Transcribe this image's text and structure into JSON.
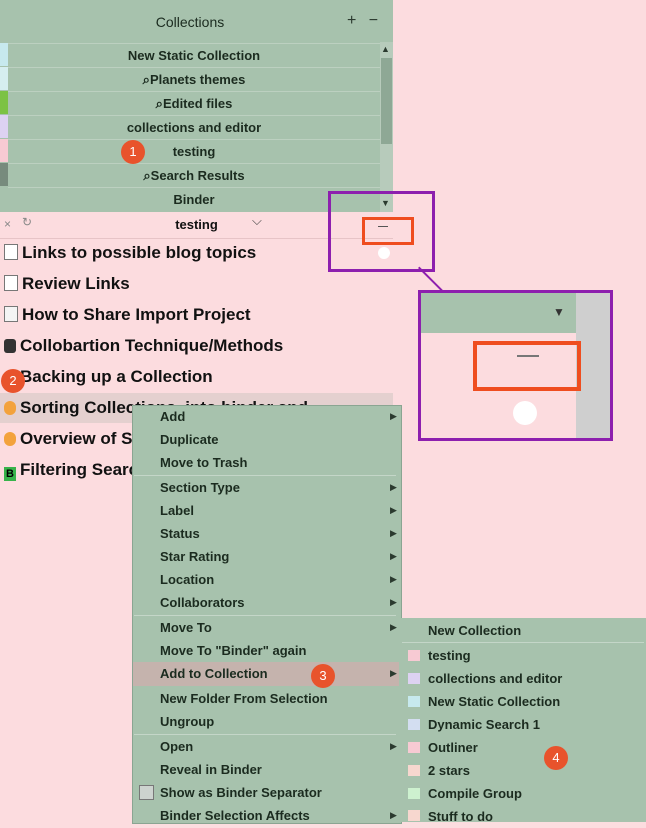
{
  "collections_panel": {
    "title": "Collections",
    "add_button": "+",
    "remove_button": "−",
    "rows": [
      {
        "label": "New Static Collection",
        "color": "#c7e9ee"
      },
      {
        "label": "⌕Planets themes",
        "color": "#d6eef0"
      },
      {
        "label": "⌕Edited files",
        "color": "#7cc244"
      },
      {
        "label": "collections and editor",
        "color": "#ddd2f2"
      },
      {
        "label": "testing",
        "color": "#f7cad3"
      },
      {
        "label": "⌕Search Results",
        "color": "#778b7d"
      },
      {
        "label": "Binder",
        "color": "#a7c2ad"
      }
    ]
  },
  "editor": {
    "title": "testing",
    "close_icon": "×",
    "redo_icon": "↻",
    "chevron": "⌵",
    "items": [
      {
        "label": "Links to possible blog topics",
        "icon": "checkbox"
      },
      {
        "label": "Review Links",
        "icon": "checkbox"
      },
      {
        "label": "How to Share Import Project",
        "icon": "document"
      },
      {
        "label": "Collobartion Technique/Methods",
        "icon": "robot"
      },
      {
        "label": "Backing up a Collection",
        "icon": "flame"
      },
      {
        "label": "Sorting Collections, into binder and",
        "icon": "flame"
      },
      {
        "label": "Overview of Sta",
        "icon": "flame"
      },
      {
        "label": "Filtering Search",
        "icon": "b-badge"
      }
    ]
  },
  "context_menu": {
    "items": [
      {
        "label": "Add",
        "submenu": true
      },
      {
        "label": "Duplicate",
        "submenu": false
      },
      {
        "label": "Move to Trash",
        "submenu": false
      },
      {
        "label": "Section Type",
        "submenu": true
      },
      {
        "label": "Label",
        "submenu": true
      },
      {
        "label": "Status",
        "submenu": true
      },
      {
        "label": "Star Rating",
        "submenu": true
      },
      {
        "label": "Location",
        "submenu": true
      },
      {
        "label": "Collaborators",
        "submenu": true
      },
      {
        "label": "Move To",
        "submenu": true
      },
      {
        "label": "Move To \"Binder\" again",
        "submenu": false
      },
      {
        "label": "Add to Collection",
        "submenu": true
      },
      {
        "label": "New Folder From Selection",
        "submenu": false
      },
      {
        "label": "Ungroup",
        "submenu": false
      },
      {
        "label": "Open",
        "submenu": true
      },
      {
        "label": "Reveal in Binder",
        "submenu": false
      },
      {
        "label": "Show as Binder Separator",
        "submenu": false
      },
      {
        "label": "Binder Selection Affects",
        "submenu": true
      }
    ]
  },
  "collection_submenu": {
    "header": "New Collection",
    "items": [
      {
        "label": "testing",
        "color": "#f7cad3"
      },
      {
        "label": "collections and editor",
        "color": "#ddd2f2"
      },
      {
        "label": "New Static Collection",
        "color": "#c7e9ee"
      },
      {
        "label": "Dynamic Search 1",
        "color": "#d3def1"
      },
      {
        "label": "Outliner",
        "color": "#f7cad3"
      },
      {
        "label": "2 stars",
        "color": "#f7d7cf"
      },
      {
        "label": "Compile Group",
        "color": "#cdf1cf"
      },
      {
        "label": "Stuff to do",
        "color": "#f7d7cf"
      }
    ]
  },
  "badges": [
    "1",
    "2",
    "3",
    "4"
  ]
}
